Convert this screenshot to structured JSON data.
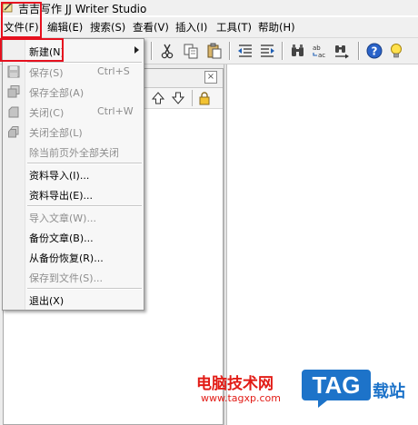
{
  "window": {
    "title": "吉吉写作 JJ Writer Studio"
  },
  "menubar": [
    {
      "id": "file",
      "label": "文件(F)"
    },
    {
      "id": "edit",
      "label": "编辑(E)"
    },
    {
      "id": "search",
      "label": "搜索(S)"
    },
    {
      "id": "view",
      "label": "查看(V)"
    },
    {
      "id": "insert",
      "label": "插入(I)"
    },
    {
      "id": "tools",
      "label": "工具(T)"
    },
    {
      "id": "help",
      "label": "帮助(H)"
    }
  ],
  "file_menu": [
    {
      "label": "新建(N)",
      "shortcut": "",
      "enabled": true,
      "submenu": true
    },
    {
      "label": "保存(S)",
      "shortcut": "Ctrl+S",
      "enabled": false,
      "icon": "save-icon"
    },
    {
      "label": "保存全部(A)",
      "shortcut": "",
      "enabled": false,
      "icon": "save-all-icon"
    },
    {
      "label": "关闭(C)",
      "shortcut": "Ctrl+W",
      "enabled": false,
      "icon": "close-doc-icon"
    },
    {
      "label": "关闭全部(L)",
      "shortcut": "",
      "enabled": false,
      "icon": "close-all-icon"
    },
    {
      "label": "除当前页外全部关闭",
      "shortcut": "",
      "enabled": false
    },
    {
      "label": "资料导入(I)...",
      "shortcut": "",
      "enabled": true
    },
    {
      "label": "资料导出(E)...",
      "shortcut": "",
      "enabled": true
    },
    {
      "label": "导入文章(W)...",
      "shortcut": "",
      "enabled": false
    },
    {
      "label": "备份文章(B)...",
      "shortcut": "",
      "enabled": true
    },
    {
      "label": "从备份恢复(R)...",
      "shortcut": "",
      "enabled": true
    },
    {
      "label": "保存到文件(S)...",
      "shortcut": "",
      "enabled": false
    },
    {
      "label": "退出(X)",
      "shortcut": "",
      "enabled": true
    }
  ],
  "panel": {
    "close_glyph": "×"
  },
  "watermark": {
    "site_name": "电脑技术网",
    "url": "www.tagxp.com",
    "logo_text": "TAG",
    "side_text": "载站"
  },
  "colors": {
    "highlight": "#e6101e",
    "watermark_red": "#e21c16",
    "logo_blue": "#1d73c9"
  }
}
